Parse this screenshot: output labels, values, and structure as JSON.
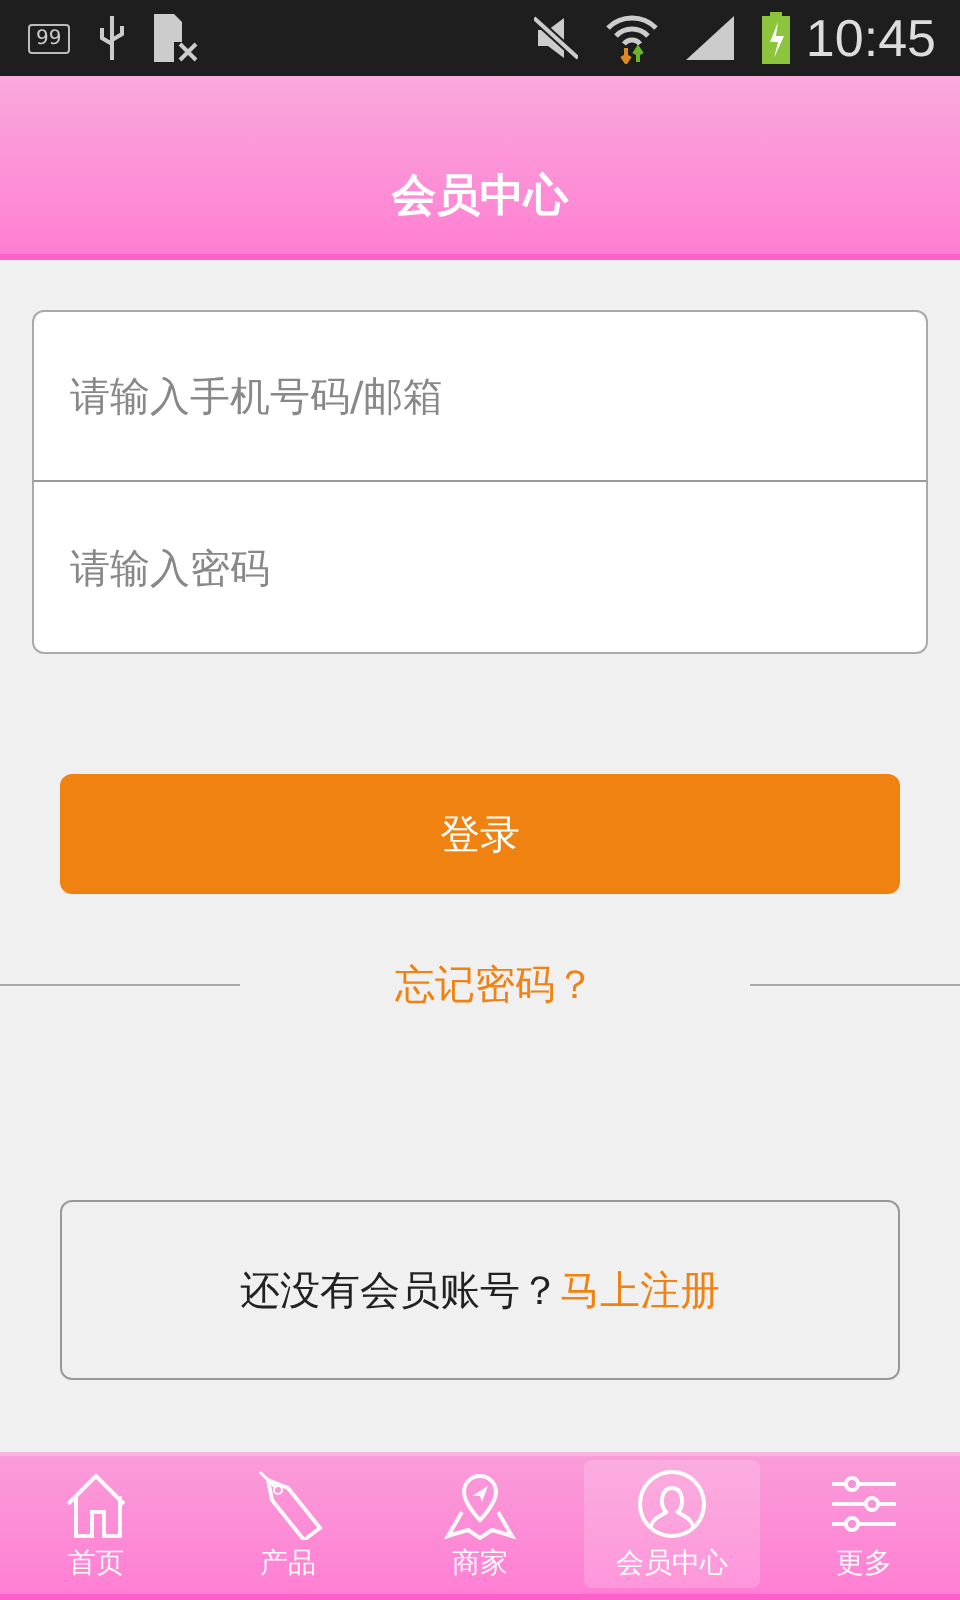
{
  "status_bar": {
    "notification_count": "99",
    "time": "10:45"
  },
  "header": {
    "title": "会员中心"
  },
  "login_form": {
    "fields": [
      {
        "placeholder": "请输入手机号码/邮箱"
      },
      {
        "placeholder": "请输入密码"
      }
    ],
    "login_button": "登录",
    "forgot_link": "忘记密码？"
  },
  "register": {
    "prompt": "还没有会员账号？",
    "link": "马上注册"
  },
  "tab_bar": [
    {
      "kind": "home",
      "label": "首页",
      "selected": false
    },
    {
      "kind": "tag",
      "label": "产品",
      "selected": false
    },
    {
      "kind": "map",
      "label": "商家",
      "selected": false
    },
    {
      "kind": "user",
      "label": "会员中心",
      "selected": true
    },
    {
      "kind": "sliders",
      "label": "更多",
      "selected": false
    }
  ]
}
